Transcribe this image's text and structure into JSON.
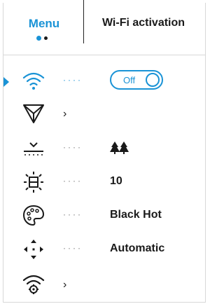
{
  "header": {
    "menu_title": "Menu",
    "tab_title": "Wi-Fi activation",
    "accent_color": "#1a93d6"
  },
  "rows": [
    {
      "icon": "wifi-icon",
      "dots": "····",
      "toggle": {
        "label": "Off",
        "state": "off"
      }
    },
    {
      "icon": "triangle-filter-icon",
      "arrow": "›"
    },
    {
      "icon": "horizon-icon",
      "dots": "····",
      "value_icon": "trees-icon"
    },
    {
      "icon": "brightness-icon",
      "dots": "····",
      "value": "10"
    },
    {
      "icon": "palette-icon",
      "dots": "····",
      "value": "Black Hot"
    },
    {
      "icon": "calibration-icon",
      "dots": "····",
      "value": "Automatic"
    },
    {
      "icon": "wifi-settings-icon",
      "arrow": "›"
    }
  ]
}
